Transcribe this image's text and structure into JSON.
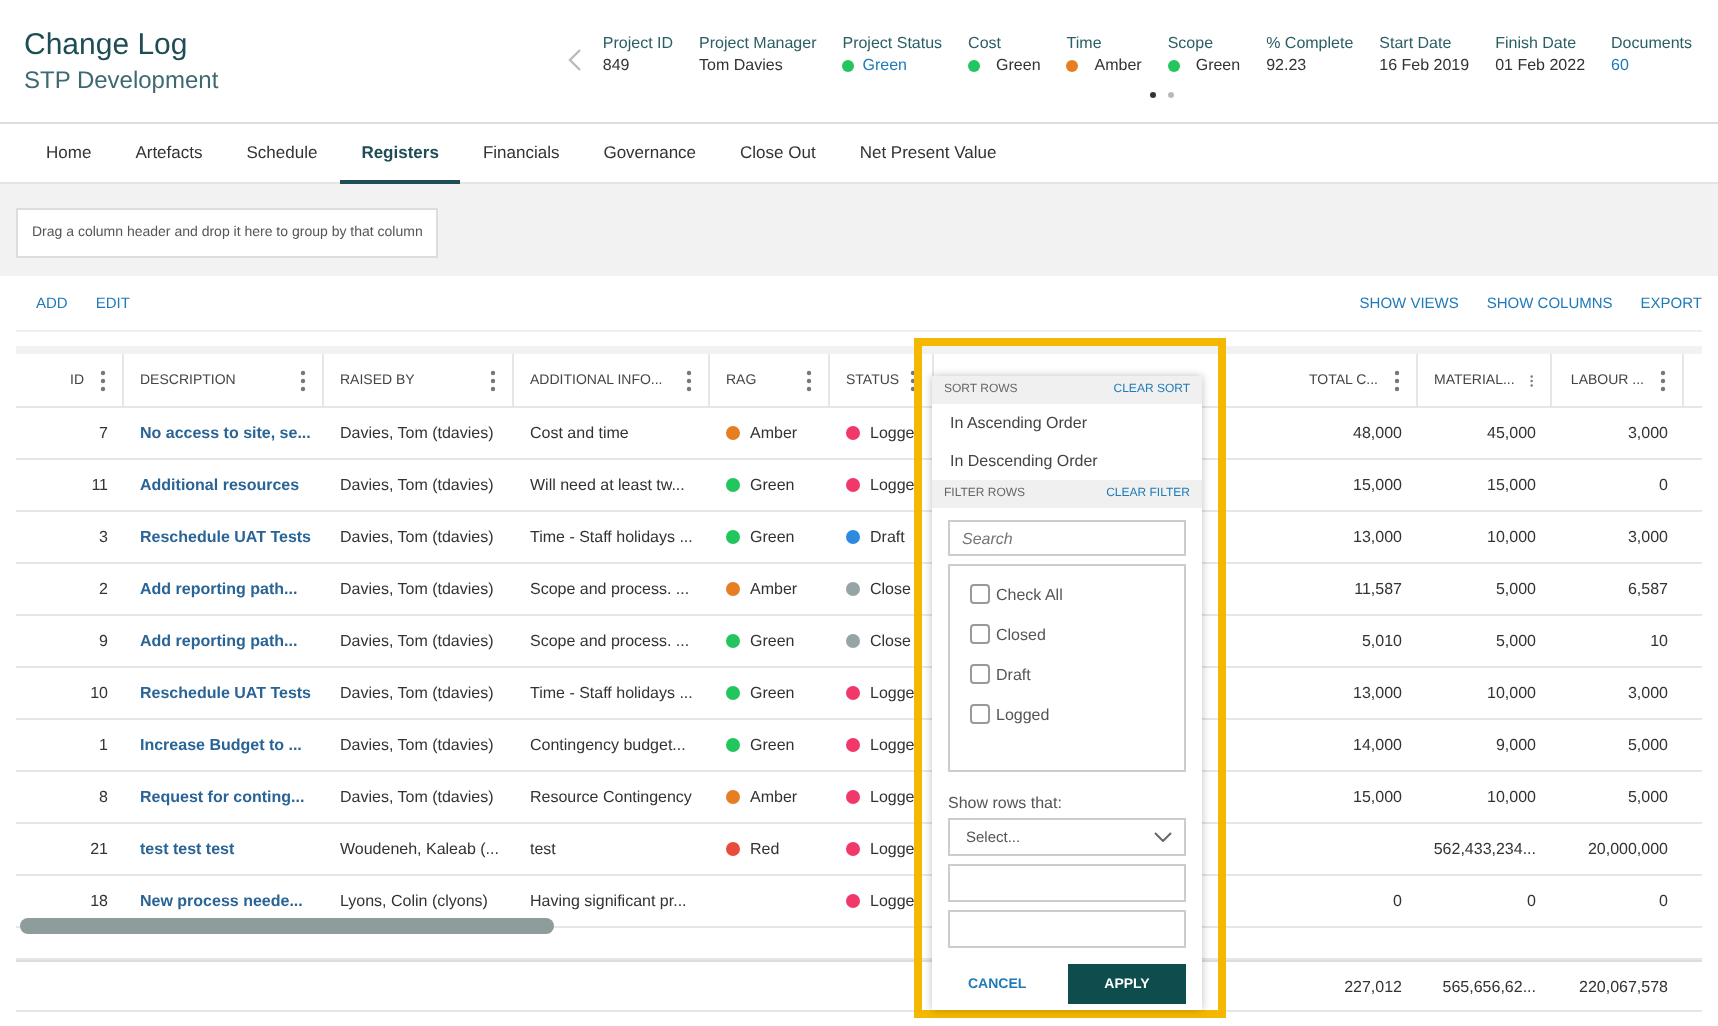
{
  "header": {
    "title": "Change Log",
    "subtitle": "STP Development",
    "metrics": [
      {
        "label": "Project ID",
        "value": "849",
        "kind": "plain"
      },
      {
        "label": "Project Manager",
        "value": "Tom Davies",
        "kind": "plain"
      },
      {
        "label": "Project Status",
        "value": "Green",
        "kind": "status",
        "color": "#22c55e"
      },
      {
        "label": "Cost",
        "value": "Green",
        "kind": "dot",
        "color": "#22c55e"
      },
      {
        "label": "Time",
        "value": "Amber",
        "kind": "dot",
        "color": "#e67e22"
      },
      {
        "label": "Scope",
        "value": "Green",
        "kind": "dot",
        "color": "#22c55e"
      },
      {
        "label": "% Complete",
        "value": "92.23",
        "kind": "plain"
      },
      {
        "label": "Start Date",
        "value": "16 Feb 2019",
        "kind": "plain"
      },
      {
        "label": "Finish Date",
        "value": "01 Feb 2022",
        "kind": "plain"
      },
      {
        "label": "Documents",
        "value": "60",
        "kind": "link"
      }
    ],
    "pager": [
      {
        "selected": true
      },
      {
        "selected": false
      }
    ]
  },
  "tabs": [
    {
      "label": "Home",
      "selected": false
    },
    {
      "label": "Artefacts",
      "selected": false
    },
    {
      "label": "Schedule",
      "selected": false
    },
    {
      "label": "Registers",
      "selected": true
    },
    {
      "label": "Financials",
      "selected": false
    },
    {
      "label": "Governance",
      "selected": false
    },
    {
      "label": "Close Out",
      "selected": false
    },
    {
      "label": "Net Present Value",
      "selected": false
    }
  ],
  "group_hint": "Drag a column header and drop it here to group by that column",
  "toolbar": {
    "left": [
      "ADD",
      "EDIT"
    ],
    "right": [
      "SHOW VIEWS",
      "SHOW COLUMNS",
      "EXPORT"
    ]
  },
  "table": {
    "columns": [
      {
        "label": "ID",
        "kind": "id"
      },
      {
        "label": "DESCRIPTION",
        "kind": "link"
      },
      {
        "label": "RAISED BY",
        "kind": "text"
      },
      {
        "label": "ADDITIONAL INFO...",
        "kind": "text"
      },
      {
        "label": "RAG",
        "kind": "dot"
      },
      {
        "label": "STATUS",
        "kind": "dot"
      },
      {
        "label": "TOTAL C...",
        "kind": "amount"
      },
      {
        "label": "MATERIAL...",
        "kind": "amount"
      },
      {
        "label": "LABOUR ...",
        "kind": "amount"
      }
    ],
    "rows": [
      {
        "cells": [
          "7",
          "No access to site, se...",
          "Davies, Tom (tdavies)",
          "Cost and time",
          {
            "label": "Amber",
            "color": "#e67e22"
          },
          {
            "label": "Logge",
            "color": "#f0386b"
          },
          "48,000",
          "45,000",
          "3,000"
        ]
      },
      {
        "cells": [
          "11",
          "Additional resources",
          "Davies, Tom (tdavies)",
          "Will need at least tw...",
          {
            "label": "Green",
            "color": "#22c55e"
          },
          {
            "label": "Logge",
            "color": "#f0386b"
          },
          "15,000",
          "15,000",
          "0"
        ]
      },
      {
        "cells": [
          "3",
          "Reschedule UAT Tests",
          "Davies, Tom (tdavies)",
          "Time - Staff holidays ...",
          {
            "label": "Green",
            "color": "#22c55e"
          },
          {
            "label": "Draft",
            "color": "#2d8ae0"
          },
          "13,000",
          "10,000",
          "3,000"
        ]
      },
      {
        "cells": [
          "2",
          "Add reporting path...",
          "Davies, Tom (tdavies)",
          "Scope and process. ...",
          {
            "label": "Amber",
            "color": "#e67e22"
          },
          {
            "label": "Close",
            "color": "#95a5a6"
          },
          "11,587",
          "5,000",
          "6,587"
        ]
      },
      {
        "cells": [
          "9",
          "Add reporting path...",
          "Davies, Tom (tdavies)",
          "Scope and process. ...",
          {
            "label": "Green",
            "color": "#22c55e"
          },
          {
            "label": "Close",
            "color": "#95a5a6"
          },
          "5,010",
          "5,000",
          "10"
        ]
      },
      {
        "cells": [
          "10",
          "Reschedule UAT Tests",
          "Davies, Tom (tdavies)",
          "Time - Staff holidays ...",
          {
            "label": "Green",
            "color": "#22c55e"
          },
          {
            "label": "Logge",
            "color": "#f0386b"
          },
          "13,000",
          "10,000",
          "3,000"
        ]
      },
      {
        "cells": [
          "1",
          "Increase Budget to ...",
          "Davies, Tom (tdavies)",
          "Contingency budget...",
          {
            "label": "Green",
            "color": "#22c55e"
          },
          {
            "label": "Logge",
            "color": "#f0386b"
          },
          "14,000",
          "9,000",
          "5,000"
        ]
      },
      {
        "cells": [
          "8",
          "Request for conting...",
          "Davies, Tom (tdavies)",
          "Resource Contingency",
          {
            "label": "Amber",
            "color": "#e67e22"
          },
          {
            "label": "Logge",
            "color": "#f0386b"
          },
          "15,000",
          "10,000",
          "5,000"
        ]
      },
      {
        "cells": [
          "21",
          "test test test",
          "Woudeneh, Kaleab (...",
          "test",
          {
            "label": "Red",
            "color": "#e74c3c"
          },
          {
            "label": "Logge",
            "color": "#f0386b"
          },
          null,
          "562,433,234...",
          "20,000,000"
        ]
      },
      {
        "cells": [
          "18",
          "New process neede...",
          "Lyons, Colin (clyons)",
          "Having significant pr...",
          null,
          {
            "label": "Logge",
            "color": "#f0386b"
          },
          "0",
          "0",
          "0"
        ]
      }
    ],
    "totals": [
      "227,012",
      "565,656,62...",
      "220,067,578"
    ]
  },
  "filter_popup": {
    "sort_title": "SORT ROWS",
    "clear_sort": "CLEAR SORT",
    "sort_options": [
      "In Ascending Order",
      "In Descending Order"
    ],
    "filter_title": "FILTER ROWS",
    "clear_filter": "CLEAR FILTER",
    "search_placeholder": "Search",
    "options": [
      {
        "label": "Check All",
        "checked": false
      },
      {
        "label": "Closed",
        "checked": false
      },
      {
        "label": "Draft",
        "checked": false
      },
      {
        "label": "Logged",
        "checked": false
      }
    ],
    "show_rows_label": "Show rows that:",
    "select_placeholder": "Select...",
    "cancel": "CANCEL",
    "apply": "APPLY"
  }
}
